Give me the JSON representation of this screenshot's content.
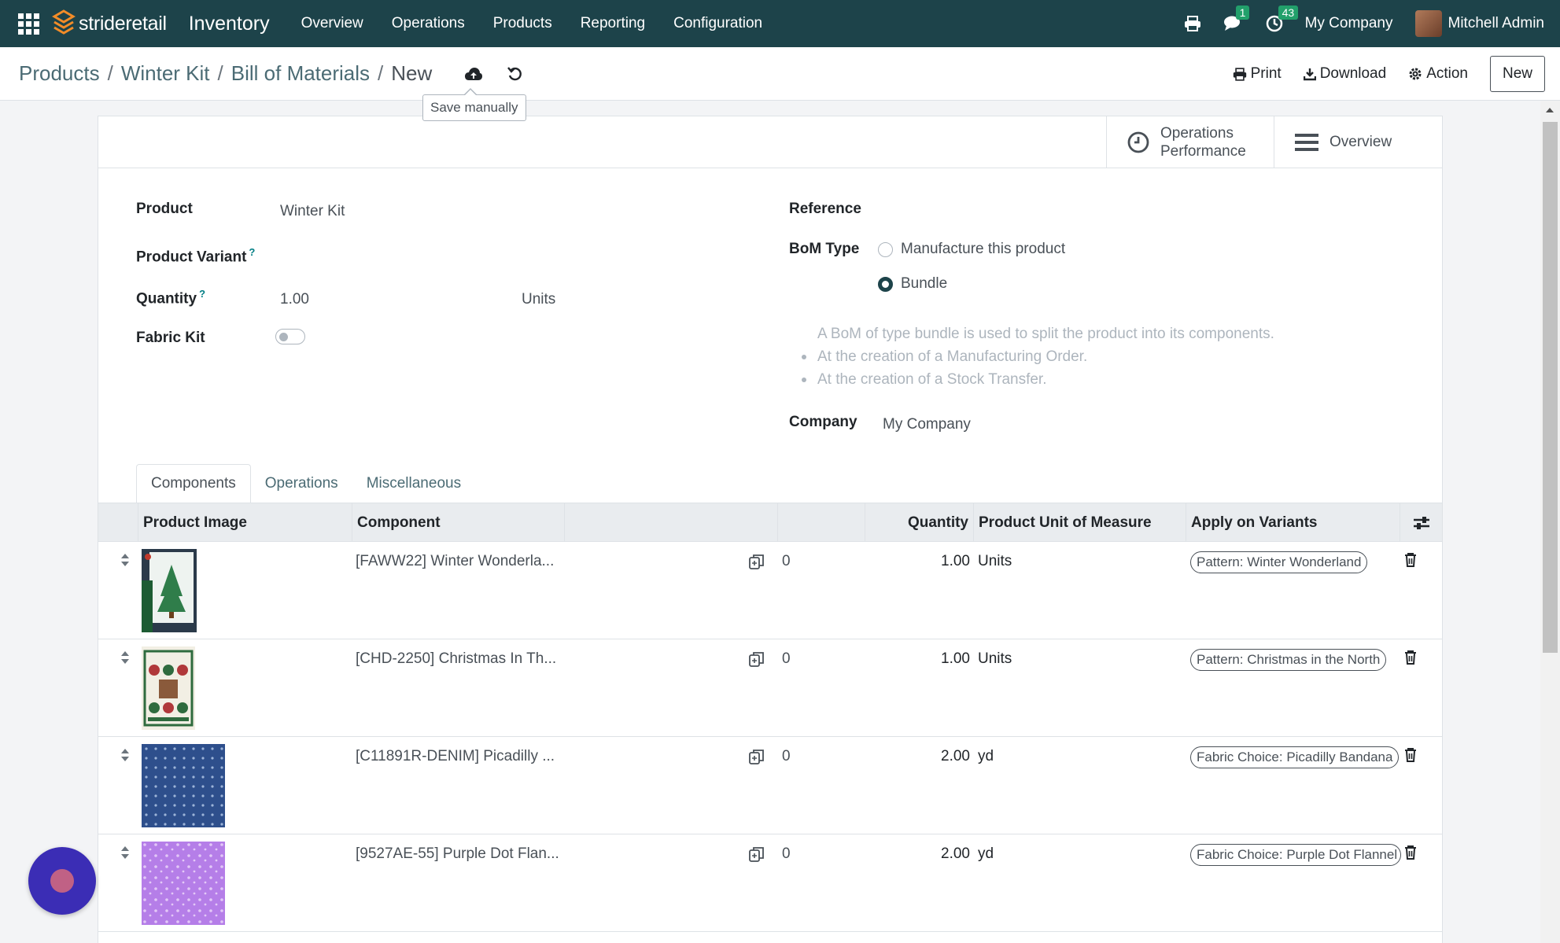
{
  "navbar": {
    "brand": "strideretail",
    "app_name": "Inventory",
    "menu": [
      "Overview",
      "Operations",
      "Products",
      "Reporting",
      "Configuration"
    ],
    "messages_badge": "1",
    "activities_badge": "43",
    "company": "My Company",
    "user": "Mitchell Admin"
  },
  "breadcrumb": {
    "items": [
      "Products",
      "Winter Kit",
      "Bill of Materials"
    ],
    "current": "New",
    "separator": "/"
  },
  "tooltip": "Save manually",
  "actions": {
    "print": "Print",
    "download": "Download",
    "action": "Action",
    "new": "New"
  },
  "smart_buttons": {
    "operations_line1": "Operations",
    "operations_line2": "Performance",
    "overview": "Overview"
  },
  "form": {
    "product_label": "Product",
    "product_value": "Winter Kit",
    "variant_label": "Product Variant",
    "quantity_label": "Quantity",
    "quantity_value": "1.00",
    "quantity_uom": "Units",
    "fabric_kit_label": "Fabric Kit",
    "help_mark": "?",
    "reference_label": "Reference",
    "bom_type_label": "BoM Type",
    "bom_options": [
      "Manufacture this product",
      "Bundle"
    ],
    "bom_selected": "Bundle",
    "help_intro": "A BoM of type bundle is used to split the product into its components.",
    "help_items": [
      "At the creation of a Manufacturing Order.",
      "At the creation of a Stock Transfer."
    ],
    "company_label": "Company",
    "company_value": "My Company"
  },
  "tabs": [
    "Components",
    "Operations",
    "Miscellaneous"
  ],
  "table": {
    "headers": {
      "image": "Product Image",
      "component": "Component",
      "quantity": "Quantity",
      "uom": "Product Unit of Measure",
      "variants": "Apply on Variants"
    },
    "rows": [
      {
        "component": "[FAWW22] Winter Wonderla...",
        "zero": "0",
        "quantity": "1.00",
        "uom": "Units",
        "variant": "Pattern: Winter Wonderland"
      },
      {
        "component": "[CHD-2250] Christmas In Th...",
        "zero": "0",
        "quantity": "1.00",
        "uom": "Units",
        "variant": "Pattern: Christmas in the North"
      },
      {
        "component": "[C11891R-DENIM] Picadilly ...",
        "zero": "0",
        "quantity": "2.00",
        "uom": "yd",
        "variant": "Fabric Choice: Picadilly Bandana"
      },
      {
        "component": "[9527AE-55] Purple Dot Flan...",
        "zero": "0",
        "quantity": "2.00",
        "uom": "yd",
        "variant": "Fabric Choice: Purple Dot Flannel"
      }
    ]
  },
  "colors": {
    "navbar": "#1d434a",
    "accent": "#017e84",
    "badge": "#22a06b"
  }
}
